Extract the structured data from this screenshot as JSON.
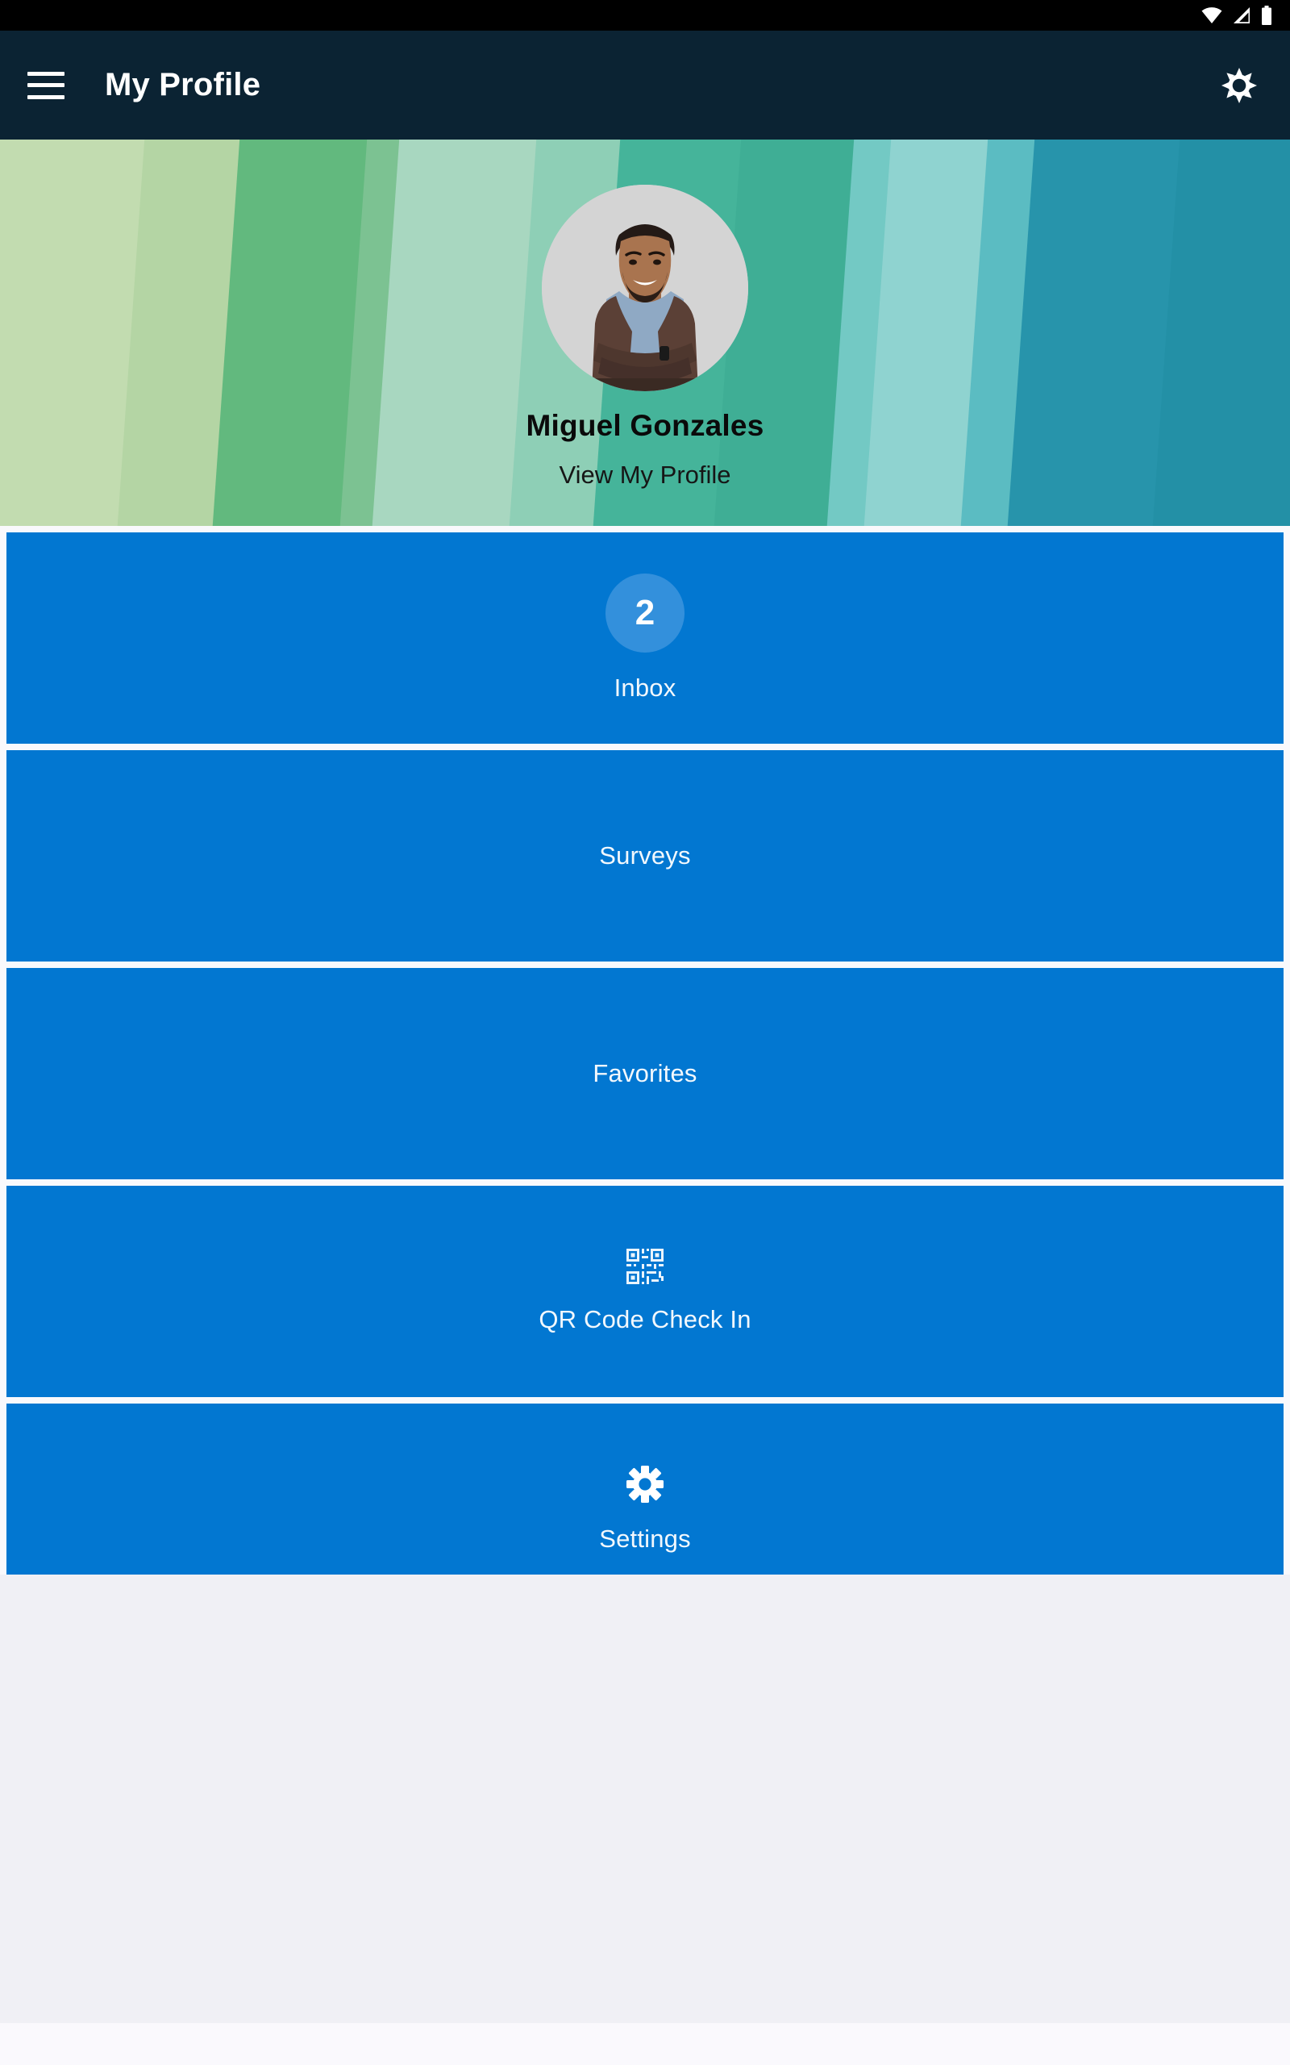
{
  "status_bar": {
    "icons": [
      "wifi-icon",
      "cellular-signal-icon",
      "battery-icon"
    ]
  },
  "app_bar": {
    "menu_icon": "hamburger-menu-icon",
    "title": "My Profile",
    "settings_icon": "gear-icon"
  },
  "hero": {
    "avatar_alt": "avatar",
    "name": "Miguel Gonzales",
    "view_profile_link": "View My Profile",
    "stripe_colors": [
      "#8cc565",
      "#a5ca7a",
      "#c2dcb0",
      "#b4d5a4",
      "#62b97e",
      "#7cc292",
      "#a8d7c0",
      "#8ecfb6",
      "#45b49a",
      "#3fae95",
      "#73c9c4",
      "#8fd3d0",
      "#5bbcc2",
      "#2794ab",
      "#2390a6"
    ]
  },
  "tiles": [
    {
      "label": "Inbox",
      "icon": "badge-count",
      "badge": "2",
      "accent": "#3390dc"
    },
    {
      "label": "Surveys",
      "icon": "none",
      "badge": "",
      "accent": ""
    },
    {
      "label": "Favorites",
      "icon": "none",
      "badge": "",
      "accent": ""
    },
    {
      "label": "QR Code Check In",
      "icon": "qr-code-icon",
      "badge": "",
      "accent": ""
    },
    {
      "label": "Settings",
      "icon": "gear-icon",
      "badge": "",
      "accent": ""
    }
  ],
  "colors": {
    "status_bar_bg": "#000000",
    "app_bar_bg": "#0b2333",
    "tile_bg": "#0277d1",
    "tile_text": "#f2f8fd",
    "page_bg": "#f0f0f5",
    "footer_bg": "#faf9fd"
  }
}
